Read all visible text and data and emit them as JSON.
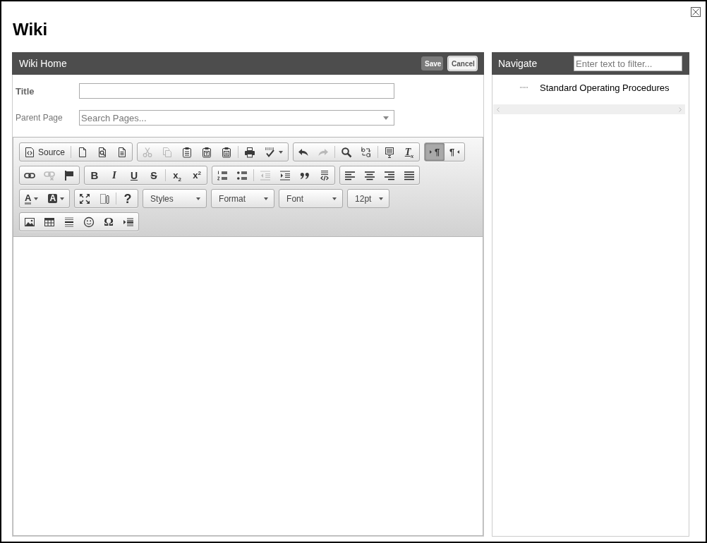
{
  "dialog": {
    "title": "Wiki"
  },
  "editor_panel": {
    "title": "Wiki Home",
    "buttons": [
      {
        "label": "Save",
        "kind": "primary"
      },
      {
        "label": "Cancel",
        "kind": "secondary"
      }
    ],
    "fields": [
      {
        "label": "Title",
        "kind": "text",
        "required": true
      },
      {
        "label": "Parent Page",
        "kind": "select",
        "placeholder": "Search Pages...",
        "required": false
      }
    ],
    "toolbar": {
      "rows": [
        {
          "groups": [
            {
              "sections": [
                [
                  {
                    "label": "Source",
                    "disabled": false
                  }
                ],
                [
                  {
                    "disabled": false
                  },
                  {
                    "disabled": false
                  },
                  {
                    "disabled": false
                  }
                ]
              ]
            },
            {
              "sections": [
                [
                  {
                    "disabled": true
                  },
                  {
                    "disabled": true
                  },
                  {
                    "disabled": false
                  },
                  {
                    "disabled": false
                  },
                  {
                    "disabled": false
                  }
                ],
                [
                  {
                    "disabled": false
                  },
                  {
                    "disabled": false
                  }
                ]
              ]
            },
            {
              "sections": [
                [
                  {
                    "disabled": false
                  },
                  {
                    "disabled": true
                  }
                ],
                [
                  {
                    "disabled": false
                  },
                  {
                    "disabled": false
                  }
                ],
                [
                  {
                    "disabled": false
                  },
                  {
                    "label": "T$_{x}$",
                    "disabled": false
                  }
                ]
              ]
            },
            {
              "sections": [
                [
                  {
                    "label": "¶",
                    "disabled": false,
                    "selected": true
                  },
                  {
                    "label": "¶",
                    "disabled": false,
                    "selected": false
                  }
                ]
              ]
            }
          ]
        },
        {
          "groups": [
            {
              "sections": [
                [
                  {
                    "disabled": false
                  },
                  {
                    "disabled": true
                  },
                  {
                    "disabled": false
                  }
                ]
              ]
            },
            {
              "sections": [
                [
                  {
                    "label": "B",
                    "disabled": false
                  },
                  {
                    "label": "I",
                    "disabled": false
                  },
                  {
                    "label": "U",
                    "disabled": false
                  },
                  {
                    "label": "S",
                    "disabled": false
                  }
                ],
                [
                  {
                    "label": "x$_{2}$",
                    "disabled": false
                  },
                  {
                    "label": "x$^{2}$",
                    "disabled": false
                  }
                ]
              ]
            },
            {
              "sections": [
                [
                  {
                    "disabled": false
                  },
                  {
                    "disabled": false
                  }
                ],
                [
                  {
                    "disabled": true
                  },
                  {
                    "disabled": false
                  },
                  {
                    "disabled": false
                  },
                  {
                    "disabled": false
                  }
                ]
              ]
            },
            {
              "sections": [
                [
                  {
                    "disabled": false
                  },
                  {
                    "disabled": false
                  },
                  {
                    "disabled": false
                  },
                  {
                    "disabled": false
                  }
                ]
              ]
            }
          ]
        },
        {
          "groups": [
            {
              "sections": [
                [
                  {
                    "label": "A",
                    "disabled": false
                  },
                  {
                    "label": "A",
                    "disabled": false
                  }
                ]
              ]
            },
            {
              "sections": [
                [
                  {
                    "disabled": false
                  },
                  {
                    "disabled": false
                  }
                ],
                [
                  {
                    "label": "?",
                    "disabled": false
                  }
                ]
              ]
            }
          ],
          "combos": [
            {
              "label": "Styles"
            },
            {
              "label": "Format"
            },
            {
              "label": "Font"
            },
            {
              "label": "12pt"
            }
          ]
        },
        {
          "groups": [
            {
              "sections": [
                [
                  {
                    "disabled": false
                  },
                  {
                    "disabled": false
                  },
                  {
                    "disabled": false
                  },
                  {
                    "disabled": false
                  },
                  {
                    "label": "Ω",
                    "disabled": false
                  },
                  {
                    "disabled": false
                  }
                ]
              ]
            }
          ]
        }
      ]
    }
  },
  "navigate_panel": {
    "title": "Navigate",
    "filter": {
      "placeholder": "Enter text to filter..."
    },
    "tree": [
      {
        "label": "Standard Operating Procedures"
      }
    ]
  }
}
